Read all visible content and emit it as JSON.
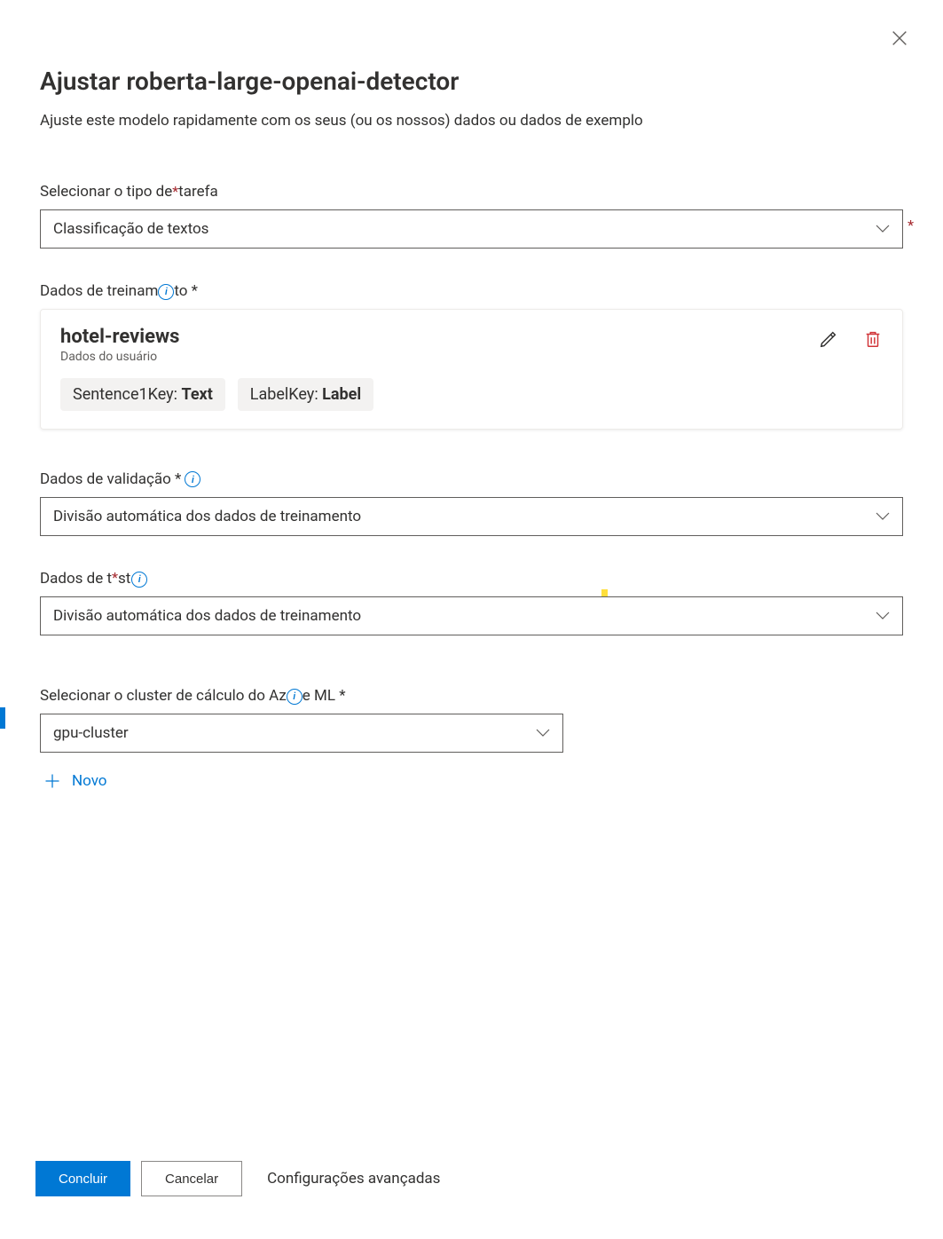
{
  "dialog": {
    "title": "Ajustar roberta-large-openai-detector",
    "subtitle": "Ajuste este modelo rapidamente com os seus (ou os nossos) dados ou dados de exemplo"
  },
  "fields": {
    "task_type_label": "Selecionar o tipo de tarefa",
    "task_type_value": "Classificação de textos",
    "training_data_label": "Dados de treinamento *",
    "training_card": {
      "title": "hotel-reviews",
      "subtitle": "Dados do usuário",
      "chip1_label": "Sentence1Key:",
      "chip1_value": "Text",
      "chip2_label": "LabelKey:",
      "chip2_value": "Label"
    },
    "validation_label": "Dados de validação *",
    "validation_value": "Divisão automática dos dados de treinamento",
    "test_label": "Dados de teste",
    "test_value": "Divisão automática dos dados de treinamento",
    "cluster_label": "Selecionar o cluster de cálculo do Azure ML *",
    "cluster_value": "gpu-cluster",
    "new_label": "Novo"
  },
  "footer": {
    "primary": "Concluir",
    "secondary": "Cancelar",
    "advanced": "Configurações avançadas"
  },
  "icons": {
    "close": "close-icon",
    "chevron": "chevron-down-icon",
    "edit": "pencil-icon",
    "delete": "trash-icon",
    "info": "info-icon",
    "plus": "plus-icon"
  }
}
